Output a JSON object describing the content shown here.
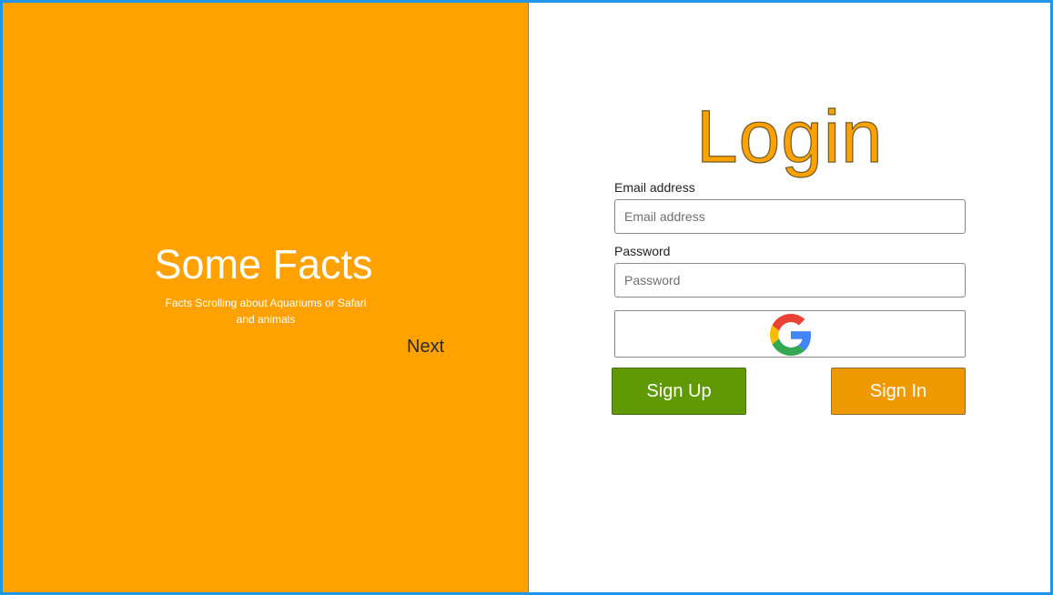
{
  "facts_panel": {
    "title": "Some Facts",
    "subtitle": "Facts Scrolling about Aquariums or Safari and animals",
    "next_label": "Next"
  },
  "login": {
    "title": "Login",
    "email_label": "Email address",
    "email_placeholder": "Email address",
    "email_value": "",
    "password_label": "Password",
    "password_placeholder": "Password",
    "password_value": "",
    "google_icon": "google-g-icon",
    "signup_label": "Sign Up",
    "signin_label": "Sign In"
  },
  "colors": {
    "accent_orange": "#ffa200",
    "frame_blue": "#2196e8",
    "signup_green": "#5f9a05",
    "signin_orange": "#ee9900"
  }
}
